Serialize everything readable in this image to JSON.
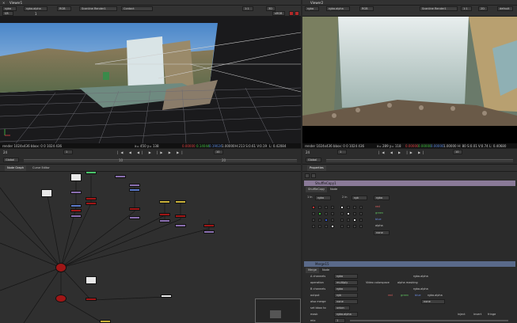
{
  "viewer1": {
    "tab": "Viewer1",
    "layer": "rgba",
    "channels": "rgba.alpha",
    "colorspace": "RGB",
    "input": "Scanline Render1",
    "input_b": "Contact",
    "zoom": "1:1",
    "fstop": "f/8",
    "frame": "1",
    "mode": "3D",
    "proj": "sRGB",
    "info": "render 1024x436 bbox: 0 0 1024 436",
    "coords": "x= 450 y= 138",
    "vals": [
      "0.00000",
      "0.14044",
      "0.19024",
      "1.00000"
    ],
    "hsv": "H:213 S:0.61 V:0.19",
    "lum": "L: 0.42084"
  },
  "viewer2": {
    "tab": "Viewer2",
    "layer": "rgba",
    "channels": "rgba.alpha",
    "colorspace": "RGB",
    "input": "Scanline Render1",
    "zoom": "1:1",
    "mode": "2D",
    "proj": "default",
    "info": "render 1024x436 bbox: 0 0 1024 436",
    "coords": "x= 289 y= 118",
    "vals": [
      "0.00000",
      "0.00000",
      "0.00000",
      "1.00000"
    ],
    "hsv": "H: 80 S:0.01 V:0.74",
    "lum": "L: 0.40680"
  },
  "timeline": {
    "fps": "24",
    "frame": "1",
    "start": "1",
    "end": "20",
    "ticks": [
      "1",
      "5",
      "10",
      "15",
      "20"
    ],
    "global": "Global",
    "step": "10"
  },
  "nodegraph": {
    "tabs": [
      "Node Graph",
      "Curve Editor"
    ]
  },
  "properties": {
    "title": "Properties",
    "shuffle": {
      "name": "ShuffleCopy1",
      "tabs": [
        "ShuffleCopy",
        "Node"
      ],
      "in1": "1 in",
      "in1v": "rgba",
      "in2": "2 in",
      "in2v": "rgb",
      "out": "rgba",
      "rows": [
        "red",
        "green",
        "blue",
        "alpha"
      ],
      "extra": "none"
    },
    "merge": {
      "name": "Merge15",
      "tabs": [
        "Merge",
        "Node"
      ],
      "fields": [
        {
          "label": "A channels",
          "value": "rgba",
          "extra": "rgba.alpha"
        },
        {
          "label": "operation",
          "value": "multiply",
          "extra": "Video colorspace",
          "extra2": "alpha masking"
        },
        {
          "label": "B channels",
          "value": "rgba",
          "extra": "rgba.alpha"
        },
        {
          "label": "output",
          "value": "rgb",
          "extra": "red",
          "extra2": "green",
          "extra3": "blue",
          "extra4": "rgba.alpha"
        },
        {
          "label": "also merge",
          "value": "none",
          "extra": "none"
        },
        {
          "label": "set bbox to",
          "value": "union"
        },
        {
          "label": "mask",
          "value": "rgba.alpha",
          "extra": "inject",
          "extra2": "invert",
          "extra3": "fringe"
        },
        {
          "label": "mix",
          "value": "1"
        }
      ]
    }
  },
  "colors": {
    "bg": "#262626",
    "panel": "#323232",
    "accent": "#c84a2a",
    "node_red": "#a01616",
    "node_purple": "#8a6fb0",
    "node_blue": "#5a78c8",
    "node_yellow": "#c9b13a"
  }
}
